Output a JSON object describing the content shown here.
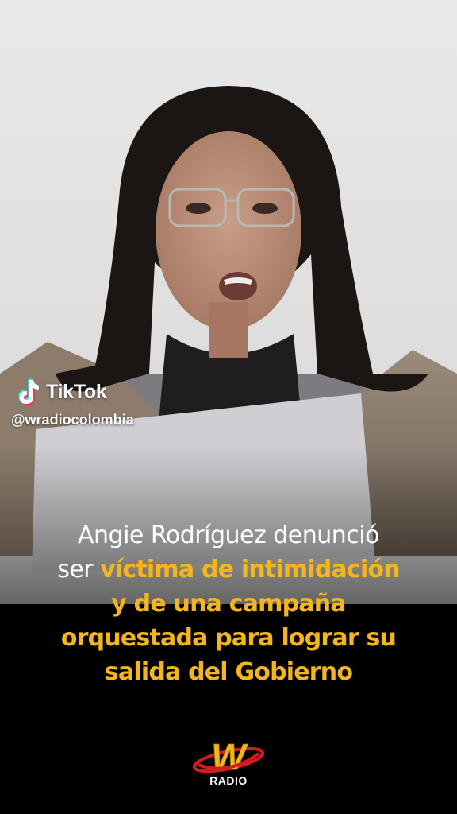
{
  "overlay": {
    "brand_name": "TikTok",
    "handle": "@wradiocolombia"
  },
  "caption": {
    "line1_white": "Angie Rodríguez denunció",
    "line2_white": "ser ",
    "line2_yellow": "víctima de intimidación",
    "line3_yellow": "y de una campaña",
    "line4_yellow": "orquestada para lograr su",
    "line5_yellow": "salida del Gobierno"
  },
  "logo": {
    "letter": "W",
    "sub": "RADIO"
  },
  "colors": {
    "accent_yellow": "#f5b51d",
    "logo_red": "#d71920",
    "background": "#000000",
    "text_white": "#ffffff"
  },
  "icons": [
    "tiktok-icon",
    "w-radio-logo"
  ]
}
